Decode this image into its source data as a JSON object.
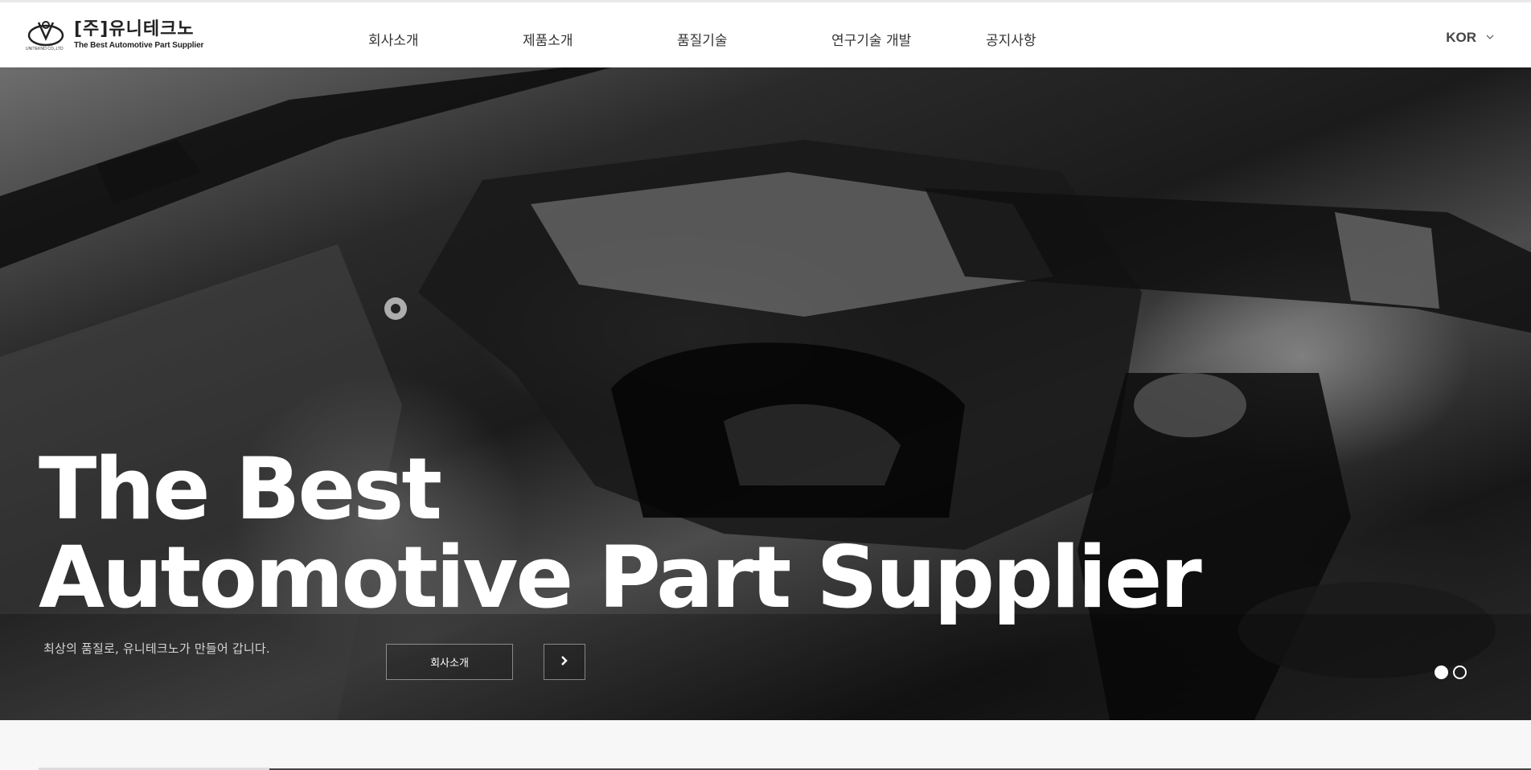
{
  "header": {
    "logo": {
      "name": "[주]유니테크노",
      "tagline": "The Best Automotive Part Supplier",
      "sub": "UNITEKNO CO.,LTD"
    },
    "nav": [
      {
        "label": "회사소개"
      },
      {
        "label": "제품소개"
      },
      {
        "label": "품질기술"
      },
      {
        "label": "연구기술 개발"
      },
      {
        "label": "공지사항"
      }
    ],
    "language": {
      "selected": "KOR",
      "icon": "chevron-down-icon"
    }
  },
  "hero": {
    "title_line1": "The Best",
    "title_line2": "Automotive Part Supplier",
    "subtitle": "최상의 품질로, 유니테크노가 만들어 갑니다.",
    "cta_label": "회사소개",
    "next_icon": "chevron-right-icon",
    "slides_total": 2,
    "active_slide": 1
  },
  "colors": {
    "header_bg": "#ffffff",
    "hero_text": "#ffffff",
    "nav_text": "#333333"
  }
}
